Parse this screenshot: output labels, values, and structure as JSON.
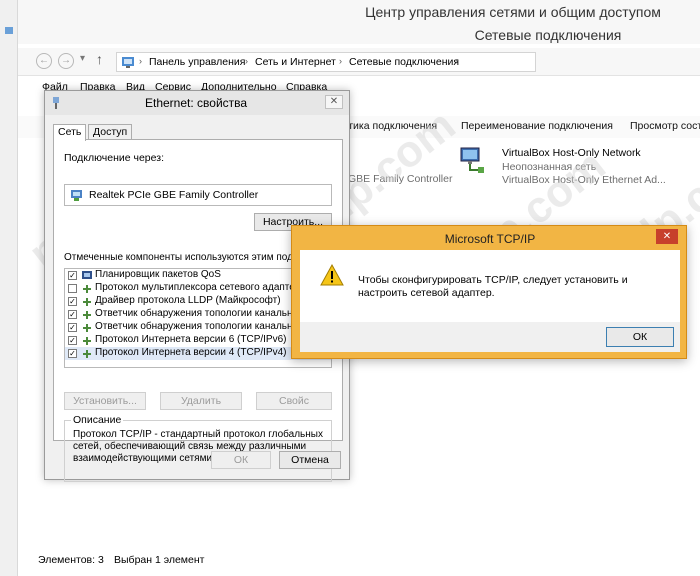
{
  "window": {
    "title": "Центр управления сетями и общим доступом",
    "subtitle": "Сетевые подключения"
  },
  "address_bar": {
    "breadcrumbs": [
      "Панель управления",
      "Сеть и Интернет",
      "Сетевые подключения"
    ]
  },
  "menu": [
    "Файл",
    "Правка",
    "Вид",
    "Сервис",
    "Дополнительно",
    "Справка"
  ],
  "command_bar": [
    "стика подключения",
    "Переименование подключения",
    "Просмотр сост"
  ],
  "adapters": [
    {
      "partial_text": "GBE Family Controller"
    },
    {
      "name": "VirtualBox Host-Only Network",
      "status": "Неопознанная сеть",
      "device": "VirtualBox Host-Only Ethernet Ad..."
    }
  ],
  "status_bar": {
    "items_count": "Элементов: 3",
    "selected": "Выбран 1 элемент"
  },
  "eth_dialog": {
    "title": "Ethernet: свойства",
    "tabs": [
      "Сеть",
      "Доступ"
    ],
    "connect_via_label": "Подключение через:",
    "adapter_name": "Realtek PCIe GBE Family Controller",
    "configure_button": "Настроить...",
    "components_label": "Отмеченные компоненты используются этим подключением:",
    "components": [
      {
        "label": "Планировщик пакетов QoS",
        "checked": true
      },
      {
        "label": "Протокол мультиплексора сетевого адаптера",
        "checked": false
      },
      {
        "label": "Драйвер протокола LLDP (Майкрософт)",
        "checked": true
      },
      {
        "label": "Ответчик обнаружения топологии канального",
        "checked": true
      },
      {
        "label": "Ответчик обнаружения топологии канального",
        "checked": true
      },
      {
        "label": "Протокол Интернета версии 6 (TCP/IPv6)",
        "checked": true
      },
      {
        "label": "Протокол Интернета версии 4 (TCP/IPv4)",
        "checked": true
      }
    ],
    "install_button": "Установить...",
    "remove_button": "Удалить",
    "properties_button": "Свойс",
    "description_label": "Описание",
    "description_text": "Протокол TCP/IP - стандартный протокол глобальных сетей, обеспечивающий связь между различными взаимодействующими сетями.",
    "ok_button": "ОК",
    "cancel_button": "Отмена"
  },
  "message_box": {
    "title": "Microsoft TCP/IP",
    "text": "Чтобы сконфигурировать TCP/IP, следует установить и настроить сетевой адаптер.",
    "ok_button": "ОК"
  },
  "watermark": "pk-help.com",
  "colors": {
    "accent": "#f2b544",
    "close_red": "#c7402b",
    "selection": "#dfe9f7"
  }
}
